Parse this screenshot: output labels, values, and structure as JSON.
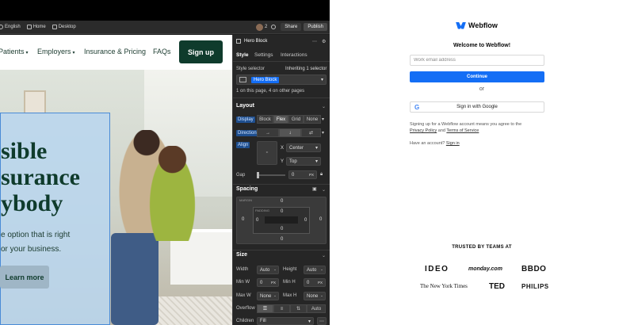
{
  "topbar": {
    "language": "English",
    "home": "Home",
    "desktop": "Desktop",
    "collab_count": "2",
    "share": "Share",
    "publish": "Publish"
  },
  "canvas": {
    "nav": {
      "patients": "Patients",
      "employers": "Employers",
      "insurance": "Insurance & Pricing",
      "faqs": "FAQs",
      "signup": "Sign up"
    },
    "hero": {
      "line1": "sible",
      "line2": "surance",
      "line3": "ybody",
      "sub1": "e option that is right",
      "sub2": "or your business.",
      "cta": "Learn more"
    }
  },
  "panel": {
    "element": "Hero Block",
    "tabs": [
      "Style",
      "Settings",
      "Interactions"
    ],
    "style_selector": "Style selector",
    "inheriting": "Inheriting 1 selector",
    "selector_chip": "Hero Block",
    "usage": "1 on this page, 4 on other pages",
    "layout": {
      "title": "Layout",
      "display_label": "Display",
      "display_options": [
        "Block",
        "Flex",
        "Grid",
        "None"
      ],
      "direction_label": "Direction",
      "align_label": "Align",
      "x_label": "X",
      "x_value": "Center",
      "y_label": "Y",
      "y_value": "Top",
      "gap_label": "Gap",
      "gap_value": "0",
      "gap_unit": "PX"
    },
    "spacing": {
      "title": "Spacing",
      "margin_label": "MARGIN",
      "padding_label": "PADDING",
      "values": [
        "0",
        "0",
        "0",
        "0",
        "0",
        "0",
        "0",
        "0"
      ]
    },
    "size": {
      "title": "Size",
      "width_label": "Width",
      "width_value": "Auto",
      "height_label": "Height",
      "height_value": "Auto",
      "minw_label": "Min W",
      "minw_value": "0",
      "minh_label": "Min H",
      "minh_value": "0",
      "maxw_label": "Max W",
      "maxw_value": "None",
      "maxh_label": "Max H",
      "maxh_value": "None",
      "unit_px": "PX",
      "unit_dash": "-",
      "overflow_label": "Overflow",
      "overflow_auto": "Auto",
      "children_label": "Children",
      "children_value": "Fill"
    }
  },
  "signin": {
    "brand": "Webflow",
    "welcome": "Welcome to Webflow!",
    "email_placeholder": "Work email address",
    "continue": "Continue",
    "or": "or",
    "google": "Sign in with Google",
    "terms_prefix": "Signing up for a Webflow account means you agree to the",
    "privacy": "Privacy Policy",
    "and": "and",
    "tos": "Terms of Service",
    "have_account": "Have an account?",
    "sign_in": "Sign in",
    "trusted": "TRUSTED BY TEAMS AT",
    "logos": [
      "IDEO",
      "monday.com",
      "BBDO",
      "The New York Times",
      "TED",
      "PHILIPS"
    ]
  },
  "colors": {
    "webflow_blue": "#146ef5",
    "brand_green": "#0f3b2c",
    "panel_bg": "#262626"
  }
}
